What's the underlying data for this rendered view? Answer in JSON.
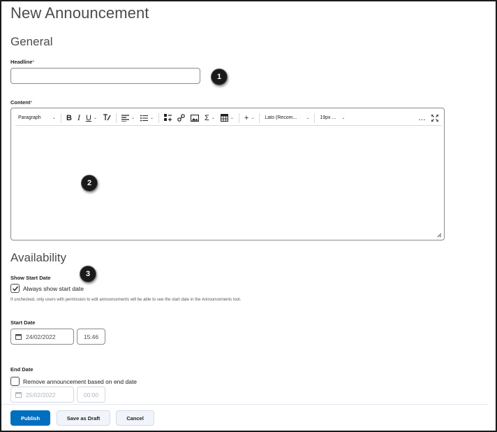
{
  "page": {
    "title": "New Announcement"
  },
  "sections": {
    "general": "General",
    "availability": "Availability"
  },
  "headline": {
    "label": "Headline",
    "required_mark": "*",
    "value": ""
  },
  "content": {
    "label": "Content",
    "required_mark": "*",
    "toolbar": {
      "paragraph": "Paragraph",
      "bold": "B",
      "italic": "I",
      "underline": "U",
      "font": "Lato (Recom...",
      "size": "19px ...",
      "insert": "+",
      "more": "…",
      "sigma": "Σ"
    },
    "value": ""
  },
  "start_date_option": {
    "label": "Show Start Date",
    "checkbox_label": "Always show start date",
    "checked": true,
    "help": "If unchecked, only users with permission to edit announcements will be able to see the start date in the Announcements tool."
  },
  "start_date": {
    "label": "Start Date",
    "date": "24/02/2022",
    "time": "15:46"
  },
  "end_date": {
    "label": "End Date",
    "checkbox_label": "Remove announcement based on end date",
    "checked": false,
    "date": "25/02/2022",
    "time": "00:00"
  },
  "callouts": [
    "1",
    "2",
    "3"
  ],
  "footer": {
    "publish": "Publish",
    "save_draft": "Save as Draft",
    "cancel": "Cancel"
  },
  "colors": {
    "primary": "#006fbf",
    "badge": "#1a1a1a"
  }
}
